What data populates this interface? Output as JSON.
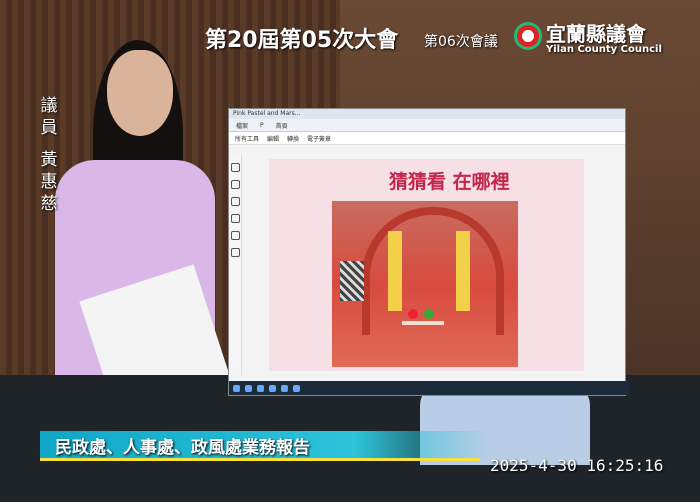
{
  "broadcast": {
    "session_title": "第20屆第05次大會",
    "meeting_number": "第06次會議",
    "council_name_cn": "宜蘭縣議會",
    "council_name_en": "Yilan County Council",
    "speaker_role": [
      "議",
      "員"
    ],
    "speaker_name": [
      "黃",
      "惠",
      "慈"
    ],
    "agenda_caption": "民政處、人事處、政風處業務報告",
    "timestamp": "2025-4-30  16:25:16"
  },
  "screen": {
    "window_title": "Pink Pastel and Mars...",
    "toolbar_tabs": [
      "檔案",
      "P",
      "首頁"
    ],
    "menu_items": [
      "所有工具",
      "編輯",
      "轉換",
      "電子簽章"
    ],
    "slide_title": "猜猜看 在哪裡"
  },
  "colors": {
    "caption_bar": "#10a7c8",
    "caption_underline": "#f6e042",
    "slide_background": "#f7dfe6",
    "slide_title": "#c4264b"
  },
  "icons": [
    "council-logo-icon",
    "windows-start-icon",
    "taskbar-app-icon"
  ]
}
